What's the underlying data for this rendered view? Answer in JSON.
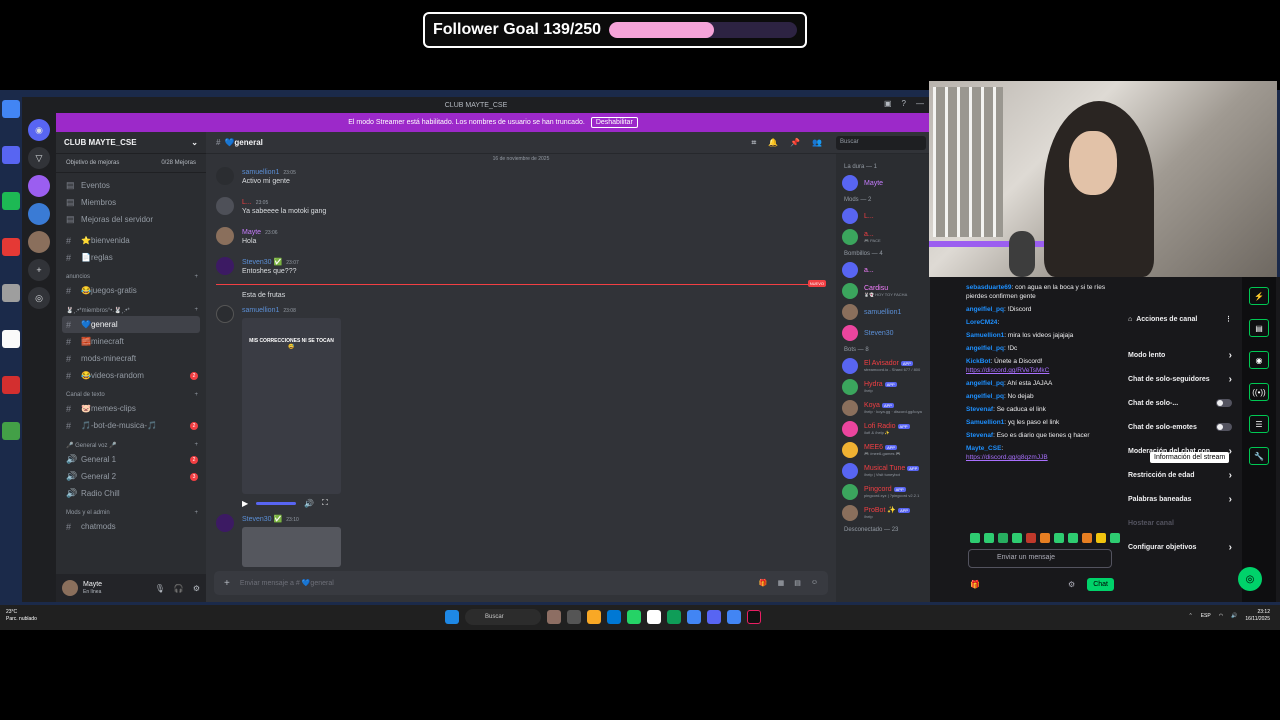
{
  "goal": {
    "label": "Follower Goal 139/250",
    "progress": 0.556,
    "fill_color": "#f5a3d8"
  },
  "discord": {
    "window_title": "CLUB MAYTE_CSE",
    "banner_text": "El modo Streamer está habilitado. Los nombres de usuario se han truncado.",
    "banner_button": "Deshabilitar",
    "server_name": "CLUB MAYTE_CSE",
    "boost_label": "Objetivo de mejoras",
    "boost_count": "0/28 Mejoras",
    "top_items": [
      "Eventos",
      "Miembros",
      "Mejoras del servidor"
    ],
    "channels_a": [
      "⭐bienvenida",
      "📄reglas"
    ],
    "cat_anuncios": "anuncios",
    "channels_b": [
      "😂juegos-gratis"
    ],
    "cat_miembros": "🐰¸.•*miembros°•.🐰¸.•*",
    "channels_c": [
      {
        "name": "💙general",
        "active": true,
        "badge": ""
      },
      {
        "name": "🧱minecraft",
        "active": false,
        "badge": ""
      },
      {
        "name": "mods-minecraft",
        "active": false,
        "badge": ""
      },
      {
        "name": "😂videos-random",
        "active": false,
        "badge": "2"
      }
    ],
    "cat_texto": "Canal de texto",
    "channels_d": [
      {
        "name": "🐷memes-clips",
        "badge": ""
      },
      {
        "name": "🎵-bot-de-musica-🎵",
        "badge": "2"
      }
    ],
    "cat_voz": "🎤 General voz 🎤",
    "voice": [
      {
        "name": "General 1",
        "badge": "2"
      },
      {
        "name": "General 2",
        "badge": "3"
      },
      {
        "name": "Radio Chill",
        "badge": ""
      }
    ],
    "cat_mods": "Mods y el admin",
    "channels_e": [
      "chatmods"
    ],
    "user": {
      "name": "Mayte",
      "status": "En línea"
    },
    "chat_channel": "💙general",
    "search_placeholder": "Buscar",
    "date_sep": "16 de noviembre de 2025",
    "messages": [
      {
        "name": "samuellion1",
        "time": "23:05",
        "text": "Activo mi gente",
        "color": "#5b8fd6"
      },
      {
        "name": "L...",
        "time": "23:05",
        "text": "Ya sabeeee la motoki gang",
        "color": "#f23f43"
      },
      {
        "name": "Mayte",
        "time": "23:06",
        "text": "Hola",
        "color": "#c77dff"
      },
      {
        "name": "Steven30 ✅",
        "time": "23:07",
        "text": "Entoshes que???",
        "color": "#5b8fd6"
      }
    ],
    "new_tag": "NUEVO",
    "msg_after_new": "Esta de frutas",
    "video_msg": {
      "name": "samuellion1",
      "time": "23:08",
      "caption": "MIS CORRECCIONES NI SE TOCAN 😅"
    },
    "last_msg": {
      "name": "Steven30 ✅",
      "time": "23:10"
    },
    "input_placeholder": "Enviar mensaje a # 💙general",
    "members": {
      "cat1": "La dura — 1",
      "cat2": "Mods — 2",
      "cat3": "Bombillos — 4",
      "cat4": "Bots — 8",
      "cat5": "Desconectado — 23",
      "list1": [
        {
          "name": "Mayte",
          "sub": "",
          "color": "#c77dff"
        }
      ],
      "list2": [
        {
          "name": "L...",
          "sub": "",
          "color": "#f23f43"
        },
        {
          "name": "a...",
          "sub": "🎮 PACE",
          "color": "#f23f43"
        }
      ],
      "list3": [
        {
          "name": "a...",
          "sub": "",
          "color": "#f47fff"
        },
        {
          "name": "Cardisu",
          "sub": "🐰👻 HOY TOY FACHA",
          "color": "#f47fff"
        },
        {
          "name": "samuellion1",
          "sub": "",
          "color": "#5b8fd6"
        },
        {
          "name": "Steven30",
          "sub": "",
          "color": "#5b8fd6"
        }
      ],
      "list4": [
        {
          "name": "El Avisador",
          "sub": "streamcord.io - Shard 677 / 800",
          "color": "#f23f43"
        },
        {
          "name": "Hydra",
          "sub": "/help",
          "color": "#f23f43"
        },
        {
          "name": "Koya",
          "sub": "/help · koya.gg · discord.gg/koya",
          "color": "#f23f43"
        },
        {
          "name": "Lofi Radio",
          "sub": "/lofi & /help ✨",
          "color": "#f23f43"
        },
        {
          "name": "MEE6",
          "sub": "🎮 /mee6-games 🎮",
          "color": "#f23f43"
        },
        {
          "name": "Musical Tune",
          "sub": "/help | Visit tuneybot",
          "color": "#f23f43"
        },
        {
          "name": "Pingcord",
          "sub": "pingcord.xyz | ?pingcord v2.2.1",
          "color": "#f23f43"
        },
        {
          "name": "ProBot ✨",
          "sub": "/help",
          "color": "#f23f43"
        }
      ],
      "app_tag": "APP"
    }
  },
  "twitch": {
    "chat": [
      {
        "name": "sebasduarte69",
        "text": ": con agua en la boca y si te ríes pierdes confirmen gente",
        "link": ""
      },
      {
        "name": "angelfiel_pq",
        "text": ": !Discord",
        "link": ""
      },
      {
        "name": "LoreCM24",
        "text": ":",
        "link": ""
      },
      {
        "name": "Samuellion1",
        "text": ": mira los videos jajajaja",
        "link": ""
      },
      {
        "name": "angelfiel_pq",
        "text": ": !Dc",
        "link": ""
      },
      {
        "name": "KickBot",
        "text": ": Únete a Discord!",
        "link": "https://discord.gg/RVeTsMkC"
      },
      {
        "name": "angelfiel_pq",
        "text": ": Ahí esta JAJAA",
        "link": ""
      },
      {
        "name": "angelfiel_pq",
        "text": ": No dejab",
        "link": ""
      },
      {
        "name": "Stevenaf",
        "text": ": Se caduca el link",
        "link": ""
      },
      {
        "name": "Samuellion1",
        "text": ": yq les paso el link",
        "link": ""
      },
      {
        "name": "Stevenaf",
        "text": ": Eso es diario que tienes q hacer",
        "link": ""
      },
      {
        "name": "Mayte_CSE",
        "text": ":",
        "link": "https://discord.gg/g8qzmJJB"
      }
    ],
    "input_placeholder": "Enviar un mensaje",
    "chat_button": "Chat",
    "menu_title": "Acciones de canal",
    "menu": [
      {
        "label": "Modo lento",
        "kind": "arrow"
      },
      {
        "label": "Chat de solo-seguidores",
        "kind": "arrow"
      },
      {
        "label": "Chat de solo-...",
        "kind": "toggle"
      },
      {
        "label": "Chat de solo-emotes",
        "kind": "toggle"
      },
      {
        "label": "Moderación del chat con",
        "kind": "arrow"
      },
      {
        "label": "Restricción de edad",
        "kind": "arrow"
      },
      {
        "label": "Palabras baneadas",
        "kind": "arrow"
      },
      {
        "label": "Hostear canal",
        "kind": "disabled"
      },
      {
        "label": "Configurar objetivos",
        "kind": "arrow"
      }
    ],
    "tooltip": "Información del stream"
  },
  "taskbar": {
    "weather_temp": "23°C",
    "weather_desc": "Parc. nublado",
    "search_label": "Buscar",
    "lang": "ESP",
    "time": "23:12",
    "date": "16/11/2025"
  }
}
